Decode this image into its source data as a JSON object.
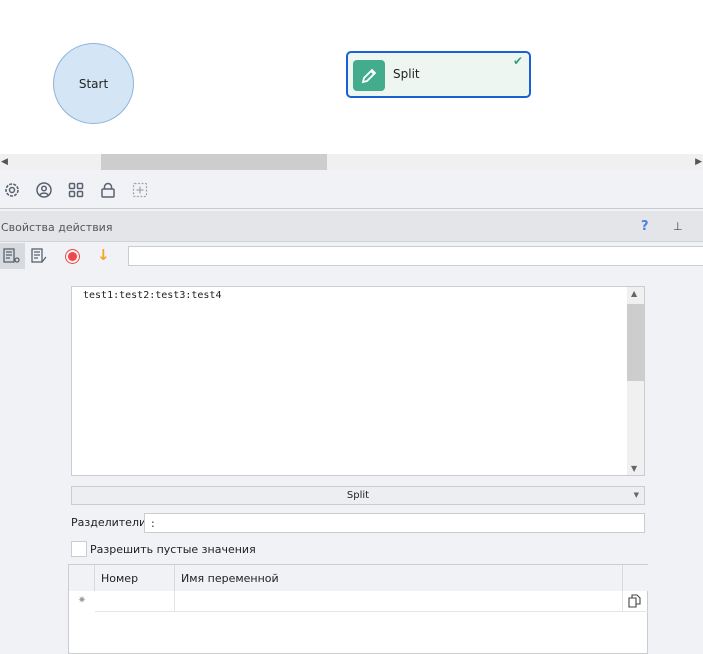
{
  "canvas": {
    "start_label": "Start",
    "split_label": "Split"
  },
  "properties": {
    "title": "Свойства действия",
    "help": "?"
  },
  "action": {
    "input_value": "",
    "text_value": "test1:test2:test3:test4",
    "mode": "Split",
    "separators_label": "Разделители",
    "separators_value": ":",
    "allow_empty_label": "Разрешить пустые значения"
  },
  "table": {
    "columns": [
      "Номер",
      "Имя переменной"
    ],
    "new_row_marker": "✷"
  }
}
